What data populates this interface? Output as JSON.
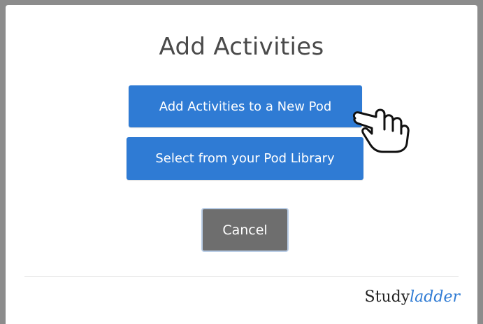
{
  "dialog": {
    "title": "Add Activities",
    "buttons": {
      "new_pod": "Add Activities to a New Pod",
      "pod_library": "Select from your Pod Library",
      "cancel": "Cancel"
    }
  },
  "brand": {
    "part1": "Study",
    "part2": "ladder"
  },
  "colors": {
    "primary_button": "#2f7bd4",
    "cancel_button": "#6e6e6e",
    "frame": "#8c8c8c"
  },
  "icons": {
    "pointer": "hand-pointer-icon"
  }
}
